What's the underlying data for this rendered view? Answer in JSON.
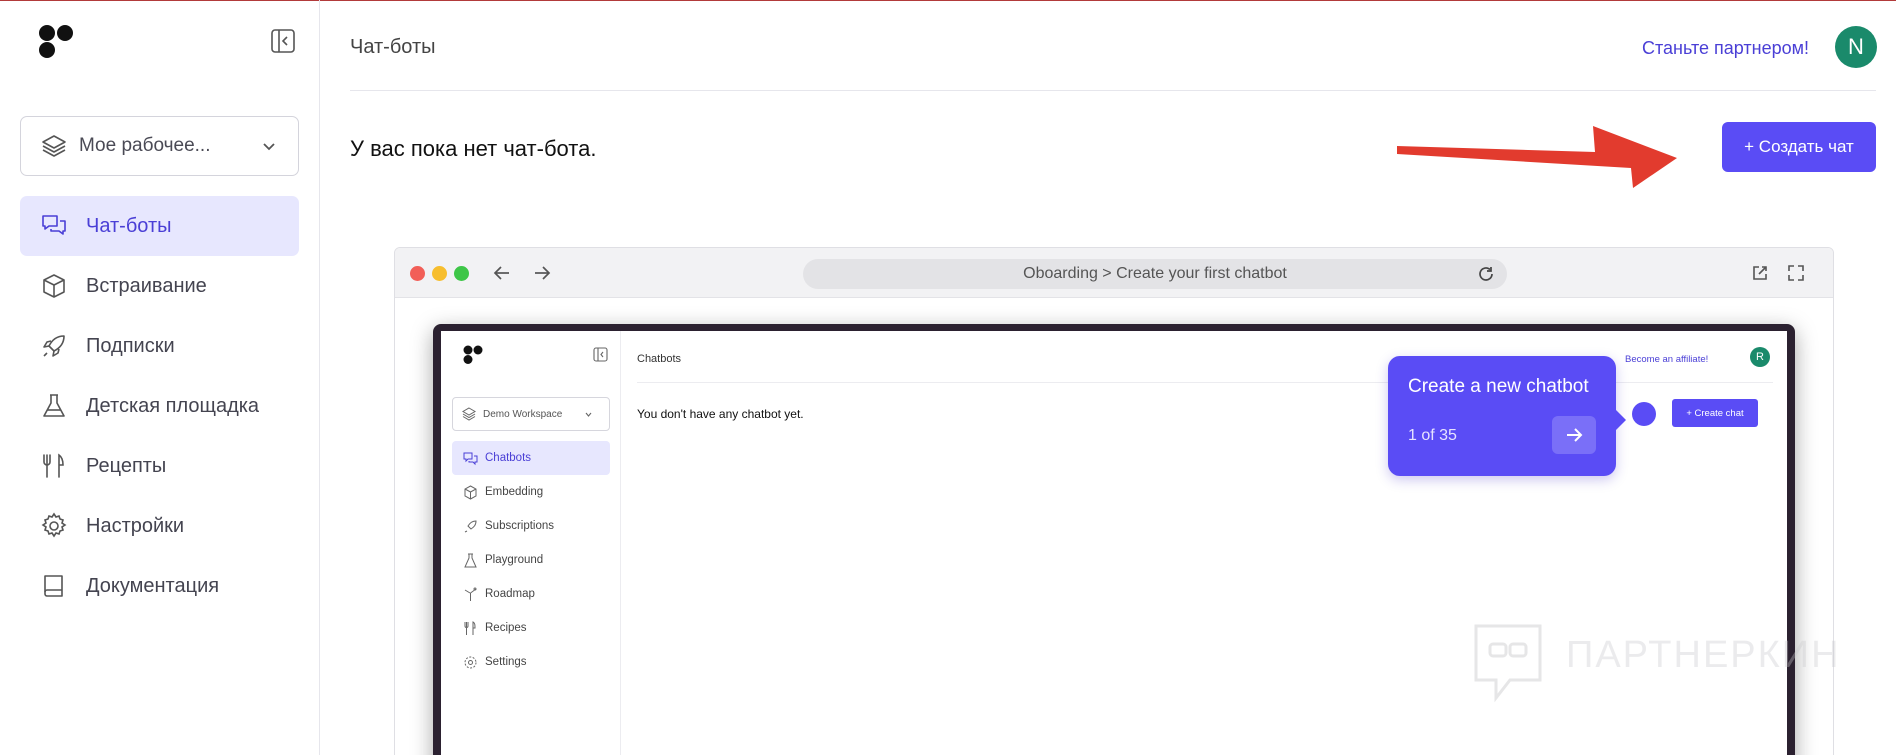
{
  "sidebar": {
    "workspace_label": "Мое рабочее...",
    "items": [
      {
        "label": "Чат-боты",
        "icon": "chat-icon",
        "active": true
      },
      {
        "label": "Встраивание",
        "icon": "cube-icon"
      },
      {
        "label": "Подписки",
        "icon": "rocket-icon"
      },
      {
        "label": "Детская площадка",
        "icon": "flask-icon"
      },
      {
        "label": "Рецепты",
        "icon": "fork-knife-icon"
      },
      {
        "label": "Настройки",
        "icon": "gear-icon"
      },
      {
        "label": "Документация",
        "icon": "book-icon"
      }
    ]
  },
  "header": {
    "title": "Чат-боты",
    "affiliate_link": "Станьте партнером!",
    "avatar_initial": "N"
  },
  "main": {
    "empty_message": "У вас пока нет чат-бота.",
    "create_button": "+ Создать чат"
  },
  "demo": {
    "url_text": "Oboarding > Create your first chatbot",
    "workspace_label": "Demo Workspace",
    "nav": [
      {
        "label": "Chatbots",
        "active": true
      },
      {
        "label": "Embedding"
      },
      {
        "label": "Subscriptions"
      },
      {
        "label": "Playground"
      },
      {
        "label": "Roadmap"
      },
      {
        "label": "Recipes"
      },
      {
        "label": "Settings"
      }
    ],
    "title": "Chatbots",
    "empty_message": "You don't have any chatbot yet.",
    "affiliate_link": "Become an affiliate!",
    "avatar_initial": "R",
    "create_button": "+ Create chat",
    "tour": {
      "title": "Create a new chatbot",
      "step": "1 of 35"
    }
  },
  "watermark": {
    "text": "ПАРТНЕРКИН"
  },
  "colors": {
    "accent": "#5a4cf5",
    "active_bg": "#e7e7fe",
    "avatar": "#1a8a6b",
    "arrow": "#e23b2e"
  }
}
